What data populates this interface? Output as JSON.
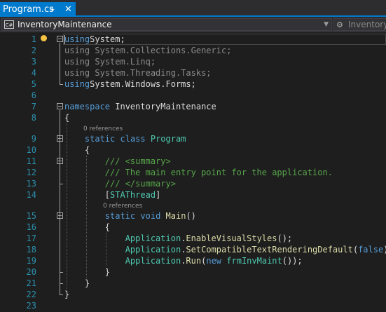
{
  "tab": {
    "title": "Program.cs",
    "pin_icon": "pin-icon",
    "close_icon": "close-icon"
  },
  "navbar": {
    "project_icon": "csharp-project-icon",
    "project": "InventoryMaintenance",
    "type_icon": "class-icon",
    "type": "InventoryMaint"
  },
  "editor": {
    "codelens": "0 references",
    "lines": [
      {
        "num": "1",
        "tokens": [
          [
            "kw",
            "using"
          ],
          [
            "",
            "System;"
          ]
        ]
      },
      {
        "num": "2",
        "tokens": [
          [
            "gray",
            "using System.Collections.Generic;"
          ]
        ]
      },
      {
        "num": "3",
        "tokens": [
          [
            "gray",
            "using System.Linq;"
          ]
        ]
      },
      {
        "num": "4",
        "tokens": [
          [
            "gray",
            "using System.Threading.Tasks;"
          ]
        ]
      },
      {
        "num": "5",
        "tokens": [
          [
            "kw",
            "using"
          ],
          [
            "",
            "System.Windows.Forms;"
          ]
        ]
      },
      {
        "num": "6",
        "tokens": []
      },
      {
        "num": "7",
        "tokens": [
          [
            "kw",
            "namespace"
          ],
          [
            "",
            " InventoryMaintenance"
          ]
        ]
      },
      {
        "num": "8",
        "tokens": [
          [
            "",
            "{"
          ]
        ]
      },
      {
        "num": "9",
        "tokens": [
          [
            "",
            "    "
          ],
          [
            "kw",
            "static"
          ],
          [
            "",
            " "
          ],
          [
            "kw",
            "class"
          ],
          [
            "",
            " "
          ],
          [
            "cls",
            "Program"
          ]
        ]
      },
      {
        "num": "10",
        "tokens": [
          [
            "",
            "    {"
          ]
        ]
      },
      {
        "num": "11",
        "tokens": [
          [
            "",
            "        "
          ],
          [
            "cm",
            "/// <summary>"
          ]
        ]
      },
      {
        "num": "12",
        "tokens": [
          [
            "",
            "        "
          ],
          [
            "cm",
            "/// The main entry point for the application."
          ]
        ]
      },
      {
        "num": "13",
        "tokens": [
          [
            "",
            "        "
          ],
          [
            "cm",
            "/// </summary>"
          ]
        ]
      },
      {
        "num": "14",
        "tokens": [
          [
            "",
            "        ["
          ],
          [
            "cls",
            "STAThread"
          ],
          [
            "",
            "]"
          ]
        ]
      },
      {
        "num": "15",
        "tokens": [
          [
            "",
            "        "
          ],
          [
            "kw",
            "static"
          ],
          [
            "",
            " "
          ],
          [
            "kw",
            "void"
          ],
          [
            "",
            " "
          ],
          [
            "fn",
            "Main"
          ],
          [
            "",
            "()"
          ]
        ]
      },
      {
        "num": "16",
        "tokens": [
          [
            "",
            "        {"
          ]
        ]
      },
      {
        "num": "17",
        "tokens": [
          [
            "",
            "            "
          ],
          [
            "cls",
            "Application"
          ],
          [
            "",
            "."
          ],
          [
            "fn",
            "EnableVisualStyles"
          ],
          [
            "",
            "();"
          ]
        ]
      },
      {
        "num": "18",
        "tokens": [
          [
            "",
            "            "
          ],
          [
            "cls",
            "Application"
          ],
          [
            "",
            "."
          ],
          [
            "fn",
            "SetCompatibleTextRenderingDefault"
          ],
          [
            "",
            "("
          ],
          [
            "kw",
            "false"
          ],
          [
            "",
            ");"
          ]
        ]
      },
      {
        "num": "19",
        "tokens": [
          [
            "",
            "            "
          ],
          [
            "cls",
            "Application"
          ],
          [
            "",
            "."
          ],
          [
            "fn",
            "Run"
          ],
          [
            "",
            "("
          ],
          [
            "kw",
            "new"
          ],
          [
            "",
            " "
          ],
          [
            "cls",
            "frmInvMaint"
          ],
          [
            "",
            "());"
          ]
        ]
      },
      {
        "num": "20",
        "tokens": [
          [
            "",
            "        }"
          ]
        ]
      },
      {
        "num": "21",
        "tokens": [
          [
            "",
            "    }"
          ]
        ]
      },
      {
        "num": "22",
        "tokens": [
          [
            "",
            "}"
          ]
        ]
      },
      {
        "num": "23",
        "tokens": []
      }
    ]
  }
}
